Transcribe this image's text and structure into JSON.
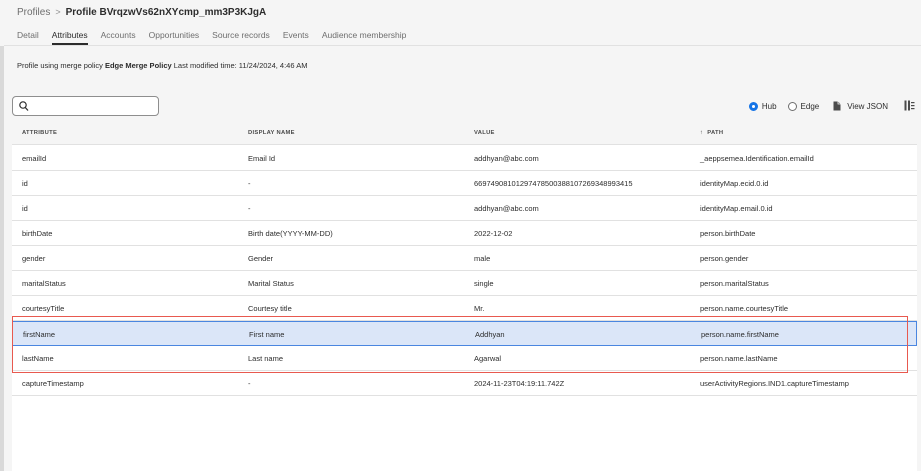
{
  "breadcrumb": {
    "parent": "Profiles",
    "separator": ">",
    "current": "Profile BVrqzwVs62nXYcmp_mm3P3KJgA"
  },
  "tabs": [
    {
      "label": "Detail",
      "active": false
    },
    {
      "label": "Attributes",
      "active": true
    },
    {
      "label": "Accounts",
      "active": false
    },
    {
      "label": "Opportunities",
      "active": false
    },
    {
      "label": "Source records",
      "active": false
    },
    {
      "label": "Events",
      "active": false
    },
    {
      "label": "Audience membership",
      "active": false
    }
  ],
  "merge": {
    "prefix": "Profile using merge policy",
    "policy": "Edge Merge Policy",
    "modified": "Last modified time: 11/24/2024, 4:46 AM"
  },
  "search": {
    "placeholder": "",
    "value": ""
  },
  "toolbar": {
    "hub_label": "Hub",
    "hub_selected": true,
    "edge_label": "Edge",
    "view_json_label": "View JSON"
  },
  "table": {
    "columns": [
      "ATTRIBUTE",
      "DISPLAY NAME",
      "VALUE",
      "PATH"
    ],
    "sort_indicator": "↑",
    "rows": [
      [
        "emailId",
        "Email Id",
        "addhyan@abc.com",
        "_aeppsemea.Identification.emailId"
      ],
      [
        "id",
        "-",
        "66974908101297478500388107269348993415",
        "identityMap.ecid.0.id"
      ],
      [
        "id",
        "-",
        "addhyan@abc.com",
        "identityMap.email.0.id"
      ],
      [
        "birthDate",
        "Birth date(YYYY-MM-DD)",
        "2022-12-02",
        "person.birthDate"
      ],
      [
        "gender",
        "Gender",
        "male",
        "person.gender"
      ],
      [
        "maritalStatus",
        "Marital Status",
        "single",
        "person.maritalStatus"
      ],
      [
        "courtesyTitle",
        "Courtesy title",
        "Mr.",
        "person.name.courtesyTitle"
      ],
      [
        "firstName",
        "First name",
        "Addhyan",
        "person.name.firstName"
      ],
      [
        "lastName",
        "Last name",
        "Agarwal",
        "person.name.lastName"
      ],
      [
        "captureTimestamp",
        "-",
        "2024-11-23T04:19:11.742Z",
        "userActivityRegions.IND1.captureTimestamp"
      ]
    ],
    "selected_row": 7
  },
  "colors": {
    "accent": "#1473e6",
    "selected_row_bg": "#dbe6f8",
    "highlight_border": "#e8594f"
  },
  "icons": {
    "search": "search-icon",
    "view_json": "document-icon",
    "columns": "column-settings-icon"
  }
}
